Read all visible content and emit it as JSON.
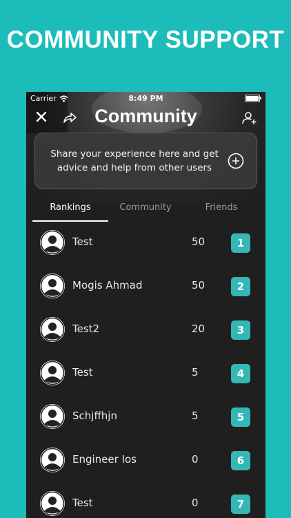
{
  "promo": {
    "title": "COMMUNITY SUPPORT"
  },
  "status_bar": {
    "carrier": "Carrier",
    "time": "8:49 PM"
  },
  "header": {
    "title": "Community"
  },
  "share_card": {
    "message": "Share your experience here and get advice and help from other users"
  },
  "tabs": [
    {
      "label": "Rankings",
      "active": true
    },
    {
      "label": "Community",
      "active": false
    },
    {
      "label": "Friends",
      "active": false
    }
  ],
  "rankings": [
    {
      "name": "Test",
      "score": "50",
      "rank": "1"
    },
    {
      "name": "Mogis Ahmad",
      "score": "50",
      "rank": "2"
    },
    {
      "name": "Test2",
      "score": "20",
      "rank": "3"
    },
    {
      "name": "Test",
      "score": "5",
      "rank": "4"
    },
    {
      "name": "Schjffhjn",
      "score": "5",
      "rank": "5"
    },
    {
      "name": "Engineer Ios",
      "score": "0",
      "rank": "6"
    },
    {
      "name": "Test",
      "score": "0",
      "rank": "7"
    }
  ],
  "icons": {
    "close": "close-icon",
    "share": "share-icon",
    "add_friend": "add-friend-icon",
    "add_post": "plus-circle-icon",
    "avatar": "user-avatar-icon",
    "wifi": "wifi-icon",
    "battery": "battery-icon"
  },
  "colors": {
    "background": "#1cbcba",
    "badge": "#35b7b5",
    "screen": "#1f1f1f"
  }
}
